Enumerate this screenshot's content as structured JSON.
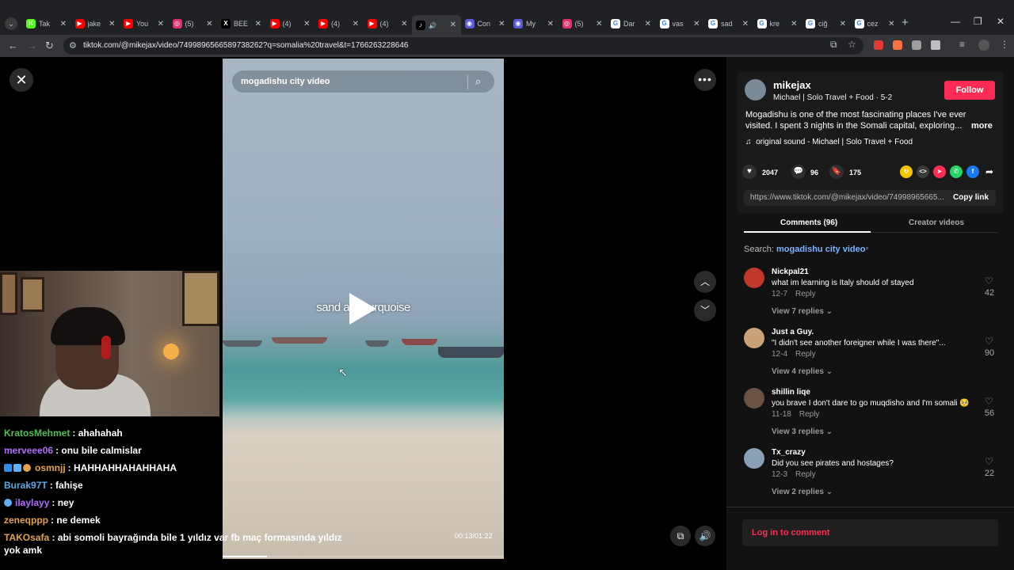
{
  "browser": {
    "tabs": [
      {
        "label": "Tak",
        "icon": "kick-icon",
        "color": "#53fc18"
      },
      {
        "label": "jake",
        "icon": "youtube-icon",
        "color": "#ff0000"
      },
      {
        "label": "You",
        "icon": "youtube-icon",
        "color": "#ff0000"
      },
      {
        "label": "(5)",
        "icon": "instagram-icon",
        "color": "#e1306c"
      },
      {
        "label": "BEE",
        "icon": "x-icon",
        "color": "#000000"
      },
      {
        "label": "(4)",
        "icon": "youtube-icon",
        "color": "#ff0000"
      },
      {
        "label": "(4)",
        "icon": "youtube-icon",
        "color": "#ff0000"
      },
      {
        "label": "(4)",
        "icon": "youtube-icon",
        "color": "#ff0000"
      },
      {
        "label": "",
        "icon": "tiktok-icon",
        "color": "#000000",
        "active": true
      },
      {
        "label": "Con",
        "icon": "ai-icon",
        "color": "#5b5bd6"
      },
      {
        "label": "My",
        "icon": "ai-icon",
        "color": "#5b5bd6"
      },
      {
        "label": "(5)",
        "icon": "instagram-icon",
        "color": "#e1306c"
      },
      {
        "label": "Dar",
        "icon": "google-icon",
        "color": "#ffffff"
      },
      {
        "label": "vas",
        "icon": "google-icon",
        "color": "#ffffff"
      },
      {
        "label": "sad",
        "icon": "google-icon",
        "color": "#ffffff"
      },
      {
        "label": "kre",
        "icon": "google-icon",
        "color": "#ffffff"
      },
      {
        "label": "ciğ",
        "icon": "google-icon",
        "color": "#ffffff"
      },
      {
        "label": "cez",
        "icon": "google-icon",
        "color": "#ffffff"
      }
    ],
    "url": "tiktok.com/@mikejax/video/7499896566589738262?q=somalia%20travel&t=1766263228646"
  },
  "video": {
    "search_query": "mogadishu city video",
    "caption": "sand and turquoise",
    "timecode": "00:13/01:22",
    "progress": 0.159
  },
  "chat": [
    {
      "user": "KratosMehmet",
      "color": "#4fc04f",
      "msg": ": ahahahah"
    },
    {
      "user": "merveee06",
      "color": "#b36bff",
      "msg": ": onu bile calmislar"
    },
    {
      "user": "osmnjj",
      "color": "#e6a24a",
      "msg": ": HAHHAHHAHAHHAHA",
      "badges": true
    },
    {
      "user": "Burak97T",
      "color": "#5aa9e6",
      "msg": ": fahişe"
    },
    {
      "user": "ilaylayy",
      "color": "#b36bff",
      "msg": ": ney",
      "badge_small": true
    },
    {
      "user": "zeneqppp",
      "color": "#e6a24a",
      "msg": ": ne demek"
    },
    {
      "user": "TAKOsafa",
      "color": "#e6a24a",
      "msg": ": abi somoli bayrağında bile 1 yıldız var fb maç formasında yıldız yok amk"
    }
  ],
  "author": {
    "name": "mikejax",
    "subtitle": "Michael | Solo Travel + Food · 5-2",
    "follow_label": "Follow",
    "description": "Mogadishu is one of the most fascinating places I've ever visited. I spent 3 nights in the Somali capital, exploring...",
    "more_label": "more",
    "sound": "original sound - Michael | Solo Travel + Food"
  },
  "stats": {
    "likes": "2047",
    "comments": "96",
    "saves": "175"
  },
  "share_link": {
    "url": "https://www.tiktok.com/@mikejax/video/74998965665...",
    "copy_label": "Copy link"
  },
  "panel_tabs": {
    "comments": "Comments (96)",
    "creator": "Creator videos"
  },
  "search": {
    "prefix": "Search:",
    "term": "mogadishu city video"
  },
  "comments": [
    {
      "user": "Nickpal21",
      "text": "what im learning is Italy should of stayed",
      "date": "12-7",
      "reply": "Reply",
      "view": "View 7 replies",
      "likes": "42",
      "avatar_color": "#c0392b"
    },
    {
      "user": "Just a Guy.",
      "text": "\"I didn't see another foreigner while I was there\"...",
      "date": "12-4",
      "reply": "Reply",
      "view": "View 4 replies",
      "likes": "90",
      "avatar_color": "#c9a27a"
    },
    {
      "user": "shillin liqe",
      "text": "you brave I don't dare to go muqdisho and I'm somali 🥺",
      "date": "11-18",
      "reply": "Reply",
      "view": "View 3 replies",
      "likes": "56",
      "avatar_color": "#6b5344"
    },
    {
      "user": "Tx_crazy",
      "text": "Did you see pirates and hostages?",
      "date": "12-3",
      "reply": "Reply",
      "view": "View 2 replies",
      "likes": "22",
      "avatar_color": "#8aa0b5"
    }
  ],
  "login_label": "Log in to comment"
}
